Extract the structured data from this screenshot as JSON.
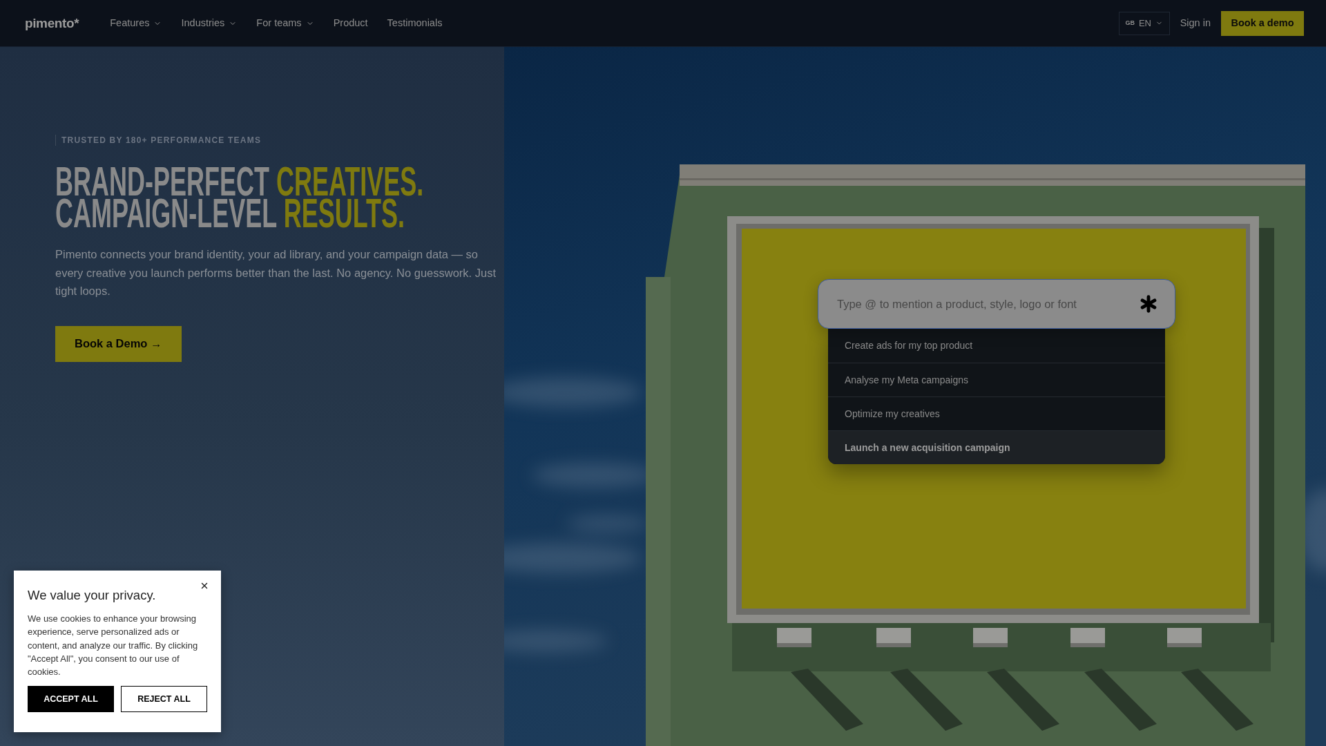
{
  "nav": {
    "logo": "pimento*",
    "items": [
      {
        "label": "Features",
        "dropdown": true
      },
      {
        "label": "Industries",
        "dropdown": true
      },
      {
        "label": "For teams",
        "dropdown": true
      },
      {
        "label": "Product",
        "dropdown": false
      },
      {
        "label": "Testimonials",
        "dropdown": false
      }
    ],
    "language": {
      "flag": "GB",
      "code": "EN"
    },
    "sign_in": "Sign in",
    "cta": "Book a demo"
  },
  "hero": {
    "eyebrow": "TRUSTED BY 180+ PERFORMANCE TEAMS",
    "heading": [
      {
        "parts": [
          {
            "text": "BRAND-PERFECT",
            "accent": false
          },
          {
            "text": "CREATIVES.",
            "accent": true
          }
        ]
      },
      {
        "parts": [
          {
            "text": "CAMPAIGN-LEVEL",
            "accent": false
          },
          {
            "text": "RESULTS.",
            "accent": true
          }
        ]
      }
    ],
    "description": "Pimento connects your brand identity, your ad library, and your campaign data — so every creative you launch performs better than the last. No agency. No guesswork. Just tight loops.",
    "cta": "Book a Demo →"
  },
  "prompt": {
    "placeholder": "Type @ to mention a product, style, logo or font",
    "suggestions": [
      {
        "label": "Create ads for my top product",
        "selected": false
      },
      {
        "label": "Analyse my Meta campaigns",
        "selected": false
      },
      {
        "label": "Optimize my creatives",
        "selected": false
      },
      {
        "label": "Launch a new acquisition campaign",
        "selected": true
      }
    ]
  },
  "cookie_banner": {
    "title": "We value your privacy.",
    "text": "We use cookies to enhance your browsing experience, serve personalized ads or content, and analyze our traffic. By clicking \"Accept All\", you consent to our use of cookies.",
    "buttons": [
      {
        "label": "ACCEPT ALL",
        "kind": "primary"
      },
      {
        "label": "REJECT ALL",
        "kind": "secondary"
      }
    ]
  }
}
